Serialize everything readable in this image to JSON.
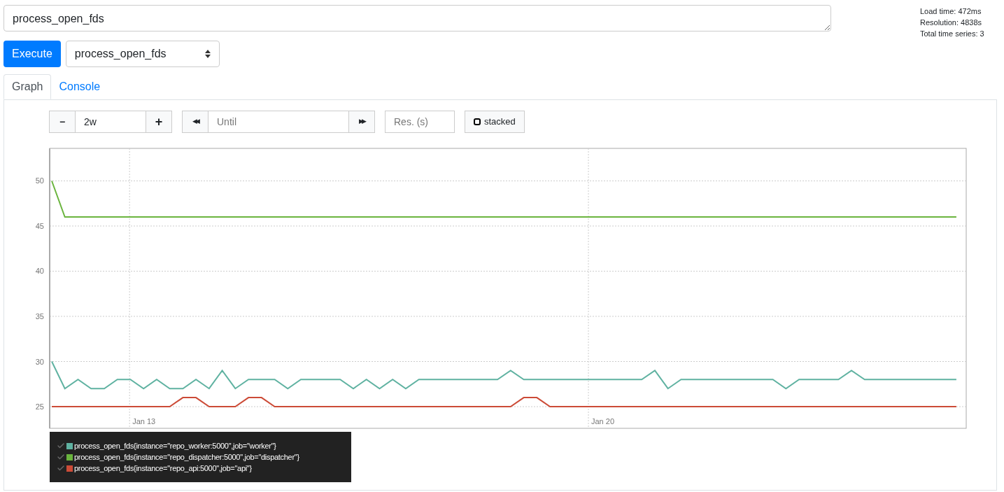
{
  "query": {
    "value": "process_open_fds"
  },
  "stats": [
    "Load time: 472ms",
    "Resolution: 4838s",
    "Total time series: 3"
  ],
  "execute_button": "Execute",
  "metric_select": {
    "value": "process_open_fds"
  },
  "tabs": [
    {
      "label": "Graph",
      "selected": true
    },
    {
      "label": "Console",
      "selected": false
    }
  ],
  "controls": {
    "minus": "−",
    "range": "2w",
    "plus": "+",
    "back": "◀◀",
    "until_placeholder": "Until",
    "forward": "▶▶",
    "resolution_placeholder": "Res. (s)",
    "stacked": {
      "label": "stacked",
      "checked": false
    }
  },
  "graph": {
    "chart_data": {
      "type": "line",
      "yticks": [
        25,
        30,
        35,
        40,
        45,
        50
      ],
      "ylim": [
        22.6,
        53.6
      ],
      "grid": true,
      "categories": [
        null,
        null,
        null,
        null,
        null,
        null,
        null,
        "Jan 13",
        null,
        null,
        null,
        null,
        null,
        null,
        null,
        null,
        null,
        null,
        null,
        null,
        null,
        null,
        null,
        null,
        null,
        null,
        null,
        null,
        null,
        null,
        null,
        null,
        null,
        null,
        null,
        null,
        null,
        null,
        null,
        null,
        null,
        null,
        "Jan 20",
        null,
        null,
        null,
        null,
        null,
        null,
        null,
        null,
        null,
        null,
        null,
        null,
        null,
        null,
        null,
        null,
        null,
        null,
        null,
        null,
        null,
        null,
        null,
        null,
        null,
        null,
        null
      ],
      "series": [
        {
          "name": "process_open_fds{instance=\"repo_worker:5000\",job=\"worker\"}",
          "color": "#5fb2a1",
          "values": [
            30,
            27,
            28,
            27,
            27,
            28,
            28,
            27,
            28,
            27,
            27,
            28,
            27,
            29,
            27,
            28,
            28,
            28,
            27,
            28,
            28,
            28,
            28,
            27,
            28,
            27,
            28,
            27,
            28,
            28,
            28,
            28,
            28,
            28,
            28,
            29,
            28,
            28,
            28,
            28,
            28,
            28,
            28,
            28,
            28,
            28,
            29,
            27,
            28,
            28,
            28,
            28,
            28,
            28,
            28,
            28,
            27,
            28,
            28,
            28,
            28,
            29,
            28,
            28,
            28,
            28,
            28,
            28,
            28,
            28
          ]
        },
        {
          "name": "process_open_fds{instance=\"repo_dispatcher:5000\",job=\"dispatcher\"}",
          "color": "#6ab43e",
          "values": [
            50,
            46,
            46,
            46,
            46,
            46,
            46,
            46,
            46,
            46,
            46,
            46,
            46,
            46,
            46,
            46,
            46,
            46,
            46,
            46,
            46,
            46,
            46,
            46,
            46,
            46,
            46,
            46,
            46,
            46,
            46,
            46,
            46,
            46,
            46,
            46,
            46,
            46,
            46,
            46,
            46,
            46,
            46,
            46,
            46,
            46,
            46,
            46,
            46,
            46,
            46,
            46,
            46,
            46,
            46,
            46,
            46,
            46,
            46,
            46,
            46,
            46,
            46,
            46,
            46,
            46,
            46,
            46,
            46,
            46
          ]
        },
        {
          "name": "process_open_fds{instance=\"repo_api:5000\",job=\"api\"}",
          "color": "#cc4b37",
          "values": [
            25,
            25,
            25,
            25,
            25,
            25,
            25,
            25,
            25,
            25,
            26,
            26,
            25,
            25,
            25,
            26,
            26,
            25,
            25,
            25,
            25,
            25,
            25,
            25,
            25,
            25,
            25,
            25,
            25,
            25,
            25,
            25,
            25,
            25,
            25,
            25,
            26,
            26,
            25,
            25,
            25,
            25,
            25,
            25,
            25,
            25,
            25,
            25,
            25,
            25,
            25,
            25,
            25,
            25,
            25,
            25,
            25,
            25,
            25,
            25,
            25,
            25,
            25,
            25,
            25,
            25,
            25,
            25,
            25,
            25
          ]
        }
      ]
    }
  }
}
